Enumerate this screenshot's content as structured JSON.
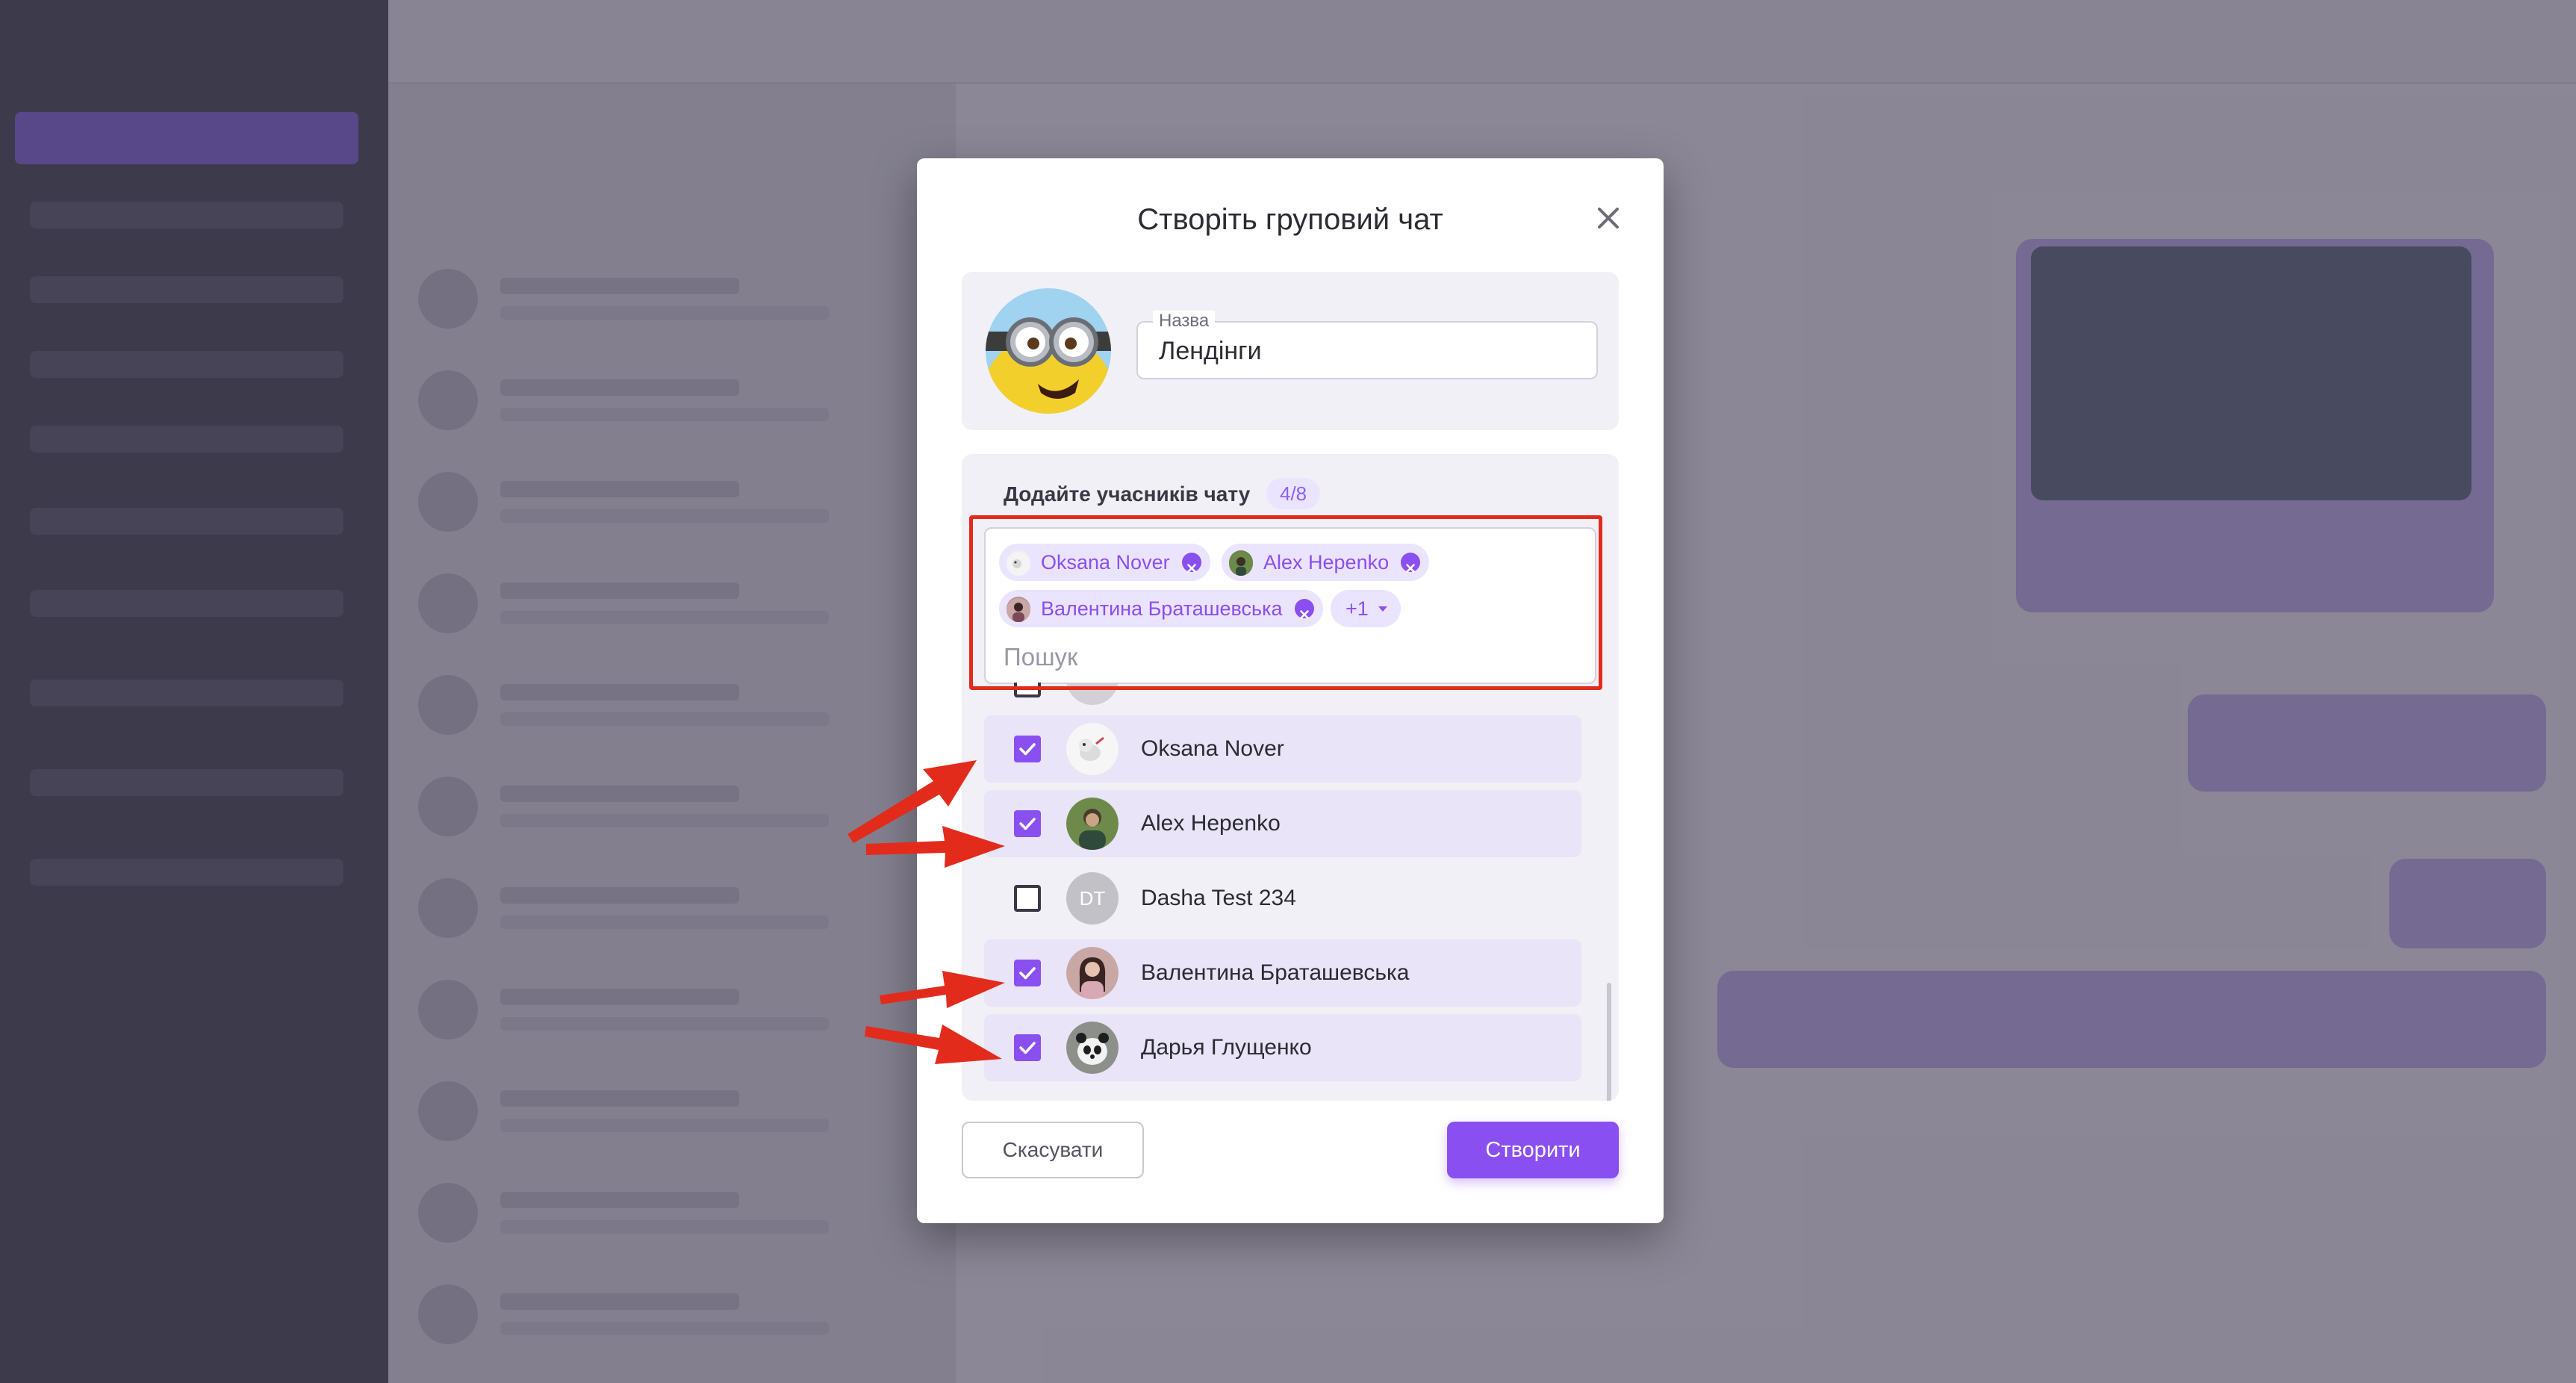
{
  "modal": {
    "title": "Створіть груповий чат",
    "name_field": {
      "label": "Назва",
      "value": "Лендінги"
    },
    "members": {
      "heading": "Додайте учасників чату",
      "count_badge": "4/8",
      "chips": [
        {
          "name": "Oksana Nover"
        },
        {
          "name": "Alex Hepenko"
        },
        {
          "name": "Валентина Браташевська"
        }
      ],
      "more_label": "+1",
      "search_placeholder": "Пошук",
      "list": [
        {
          "name": "Oksana Nover",
          "checked": true
        },
        {
          "name": "Alex Hepenko",
          "checked": true
        },
        {
          "name": "Dasha Test 234",
          "initials": "DT",
          "checked": false
        },
        {
          "name": "Валентина Браташевська",
          "checked": true
        },
        {
          "name": "Дарья Глущенко",
          "checked": true
        }
      ]
    },
    "buttons": {
      "cancel": "Скасувати",
      "create": "Створити"
    }
  },
  "colors": {
    "accent": "#8a4ff0",
    "accent_soft": "#ebe4ff",
    "annotation_red": "#e32b1c"
  }
}
